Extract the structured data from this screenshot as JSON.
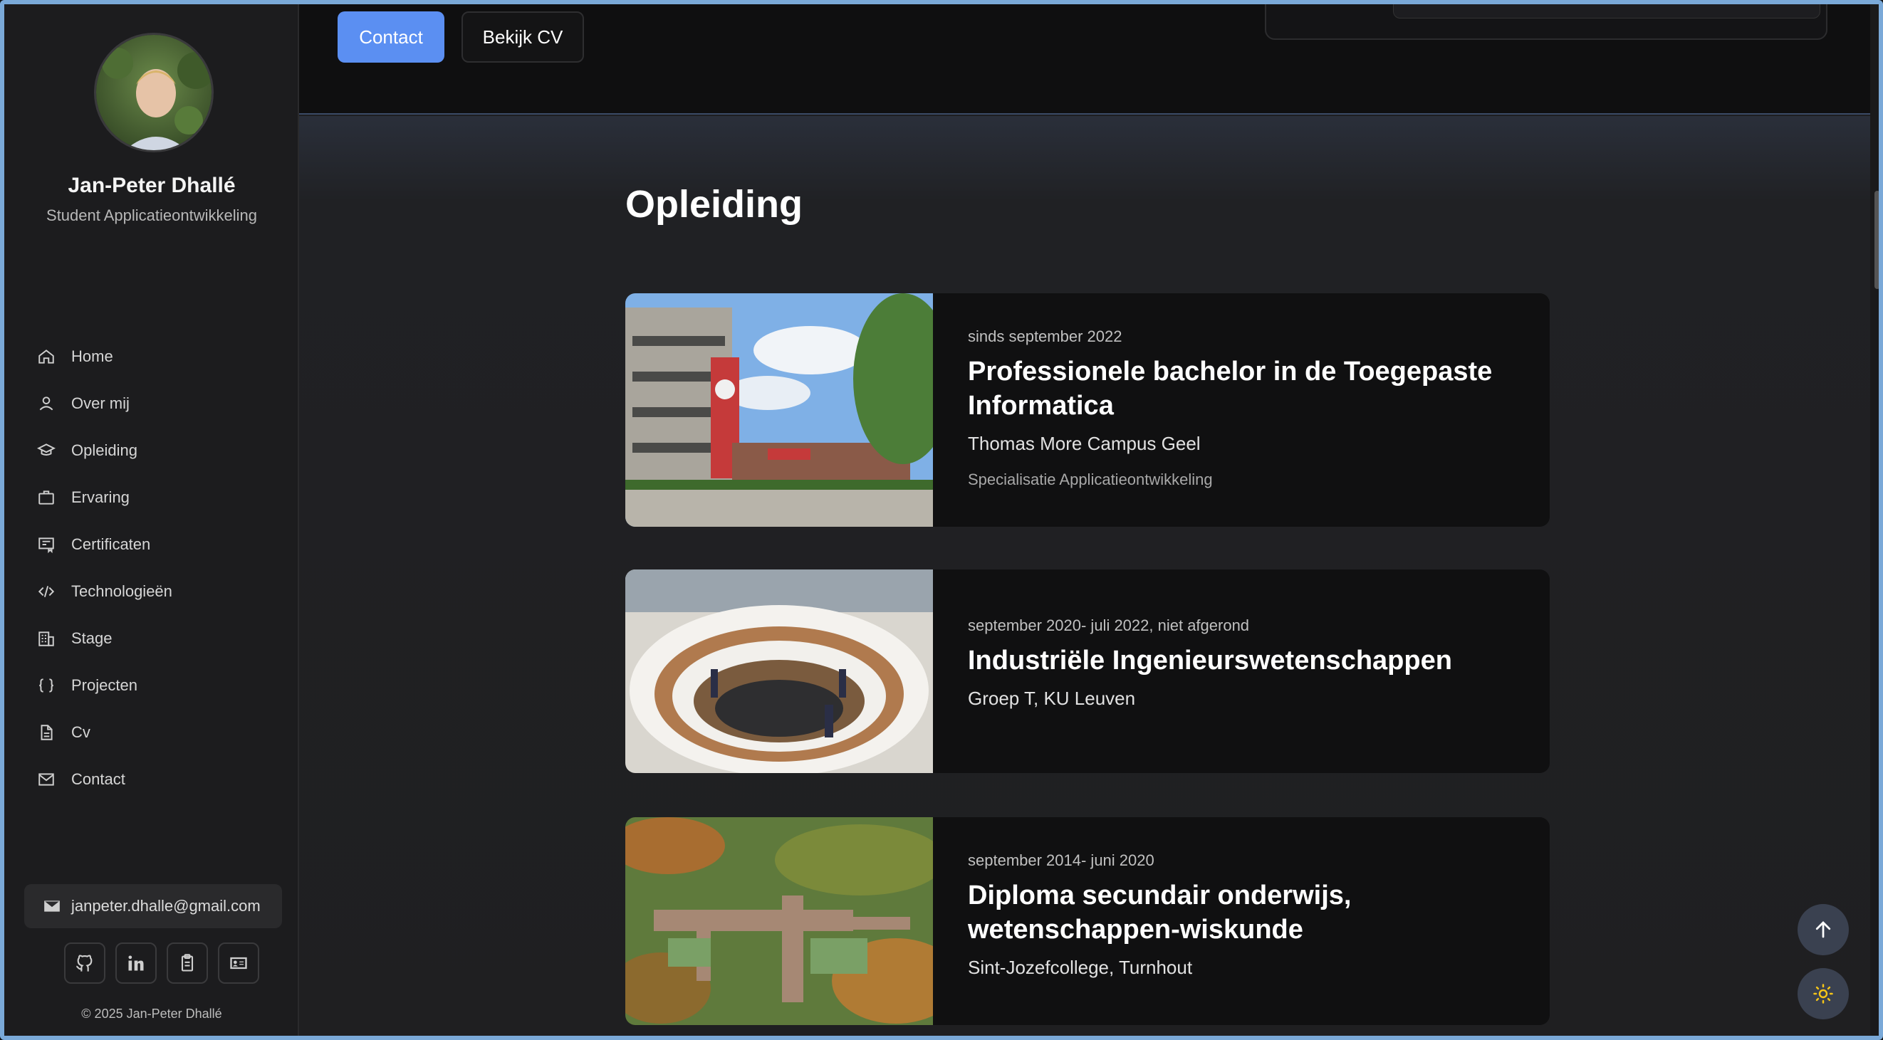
{
  "profile": {
    "name": "Jan-Peter Dhallé",
    "role": "Student Applicatieontwikkeling"
  },
  "nav": [
    {
      "label": "Home",
      "icon": "home-icon"
    },
    {
      "label": "Over mij",
      "icon": "user-icon"
    },
    {
      "label": "Opleiding",
      "icon": "graduation-cap-icon"
    },
    {
      "label": "Ervaring",
      "icon": "briefcase-icon"
    },
    {
      "label": "Certificaten",
      "icon": "certificate-icon"
    },
    {
      "label": "Technologieën",
      "icon": "code-icon"
    },
    {
      "label": "Stage",
      "icon": "building-icon"
    },
    {
      "label": "Projecten",
      "icon": "braces-icon"
    },
    {
      "label": "Cv",
      "icon": "document-icon"
    },
    {
      "label": "Contact",
      "icon": "mail-icon"
    }
  ],
  "sidebar_footer": {
    "email": "janpeter.dhalle@gmail.com",
    "socials": [
      "github-icon",
      "linkedin-icon",
      "clipboard-icon",
      "id-card-icon"
    ],
    "copyright": "© 2025 Jan-Peter Dhallé"
  },
  "hero": {
    "contact_label": "Contact",
    "cv_label": "Bekijk CV"
  },
  "education": {
    "title": "Opleiding",
    "items": [
      {
        "date": "sinds september 2022",
        "title": "Professionele bachelor in de Toegepaste Informatica",
        "school": "Thomas More Campus Geel",
        "extra": "Specialisatie Applicatieontwikkeling"
      },
      {
        "date": "september 2020- juli 2022, niet afgerond",
        "title": "Industriële Ingenieurswetenschappen",
        "school": "Groep T, KU Leuven"
      },
      {
        "date": "september 2014- juni 2020",
        "title": "Diploma secundair onderwijs, wetenschappen-wiskunde",
        "school": "Sint-Jozefcollege, Turnhout"
      }
    ]
  },
  "floating": {
    "scroll_top_icon": "arrow-up-icon",
    "theme_icon": "sun-icon",
    "theme_color": "#f5c518",
    "accent": "#5b8ff2"
  }
}
